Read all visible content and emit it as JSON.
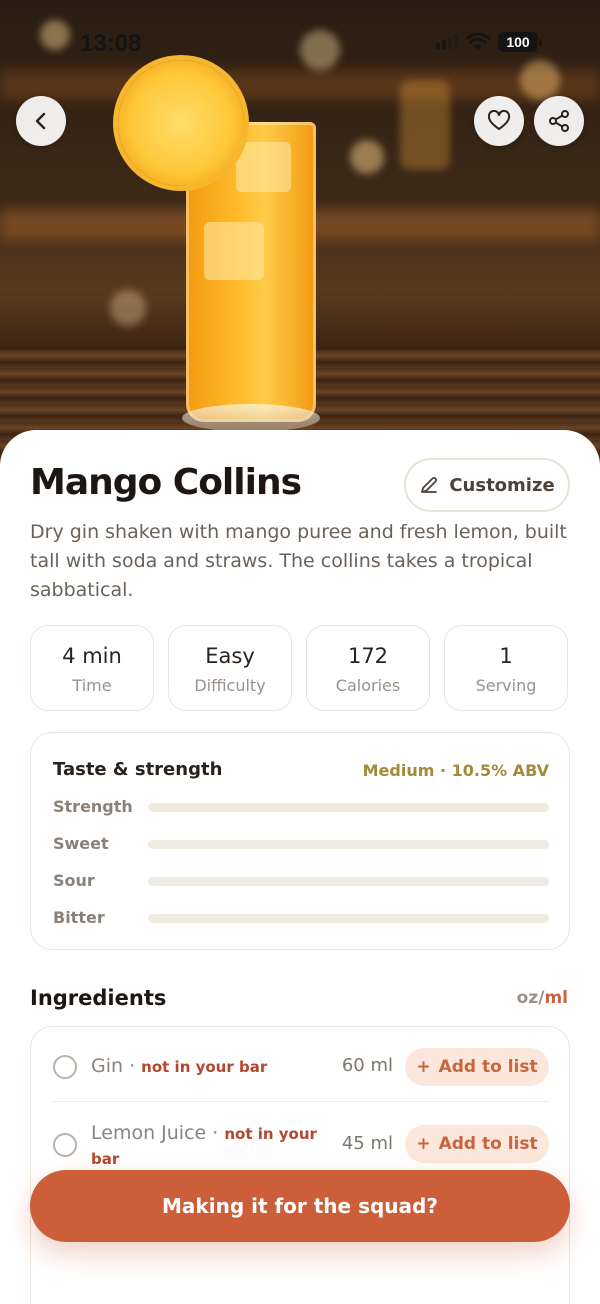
{
  "status_bar": {
    "time": "13:08",
    "battery": "100"
  },
  "header": {
    "back_icon": "chevron-left-icon",
    "favorite_icon": "heart-icon",
    "share_icon": "share-icon"
  },
  "recipe": {
    "title": "Mango Collins",
    "customize_label": "Customize",
    "description": "Dry gin shaken with mango puree and fresh lemon, built tall with soda and straws. The collins takes a tropical sabbatical.",
    "stats": [
      {
        "value": "4 min",
        "label": "Time"
      },
      {
        "value": "Easy",
        "label": "Difficulty"
      },
      {
        "value": "172",
        "label": "Calories"
      },
      {
        "value": "1",
        "label": "Serving"
      }
    ]
  },
  "taste": {
    "title": "Taste & strength",
    "meta": "Medium · 10.5% ABV",
    "rows": [
      {
        "label": "Strength",
        "level": 0
      },
      {
        "label": "Sweet",
        "level": 0
      },
      {
        "label": "Sour",
        "level": 0
      },
      {
        "label": "Bitter",
        "level": 0
      }
    ]
  },
  "ingredients": {
    "title": "Ingredients",
    "unit_oz": "oz",
    "unit_sep": "/",
    "unit_ml": "ml",
    "items": [
      {
        "name": "Gin",
        "note": "not in your bar",
        "amount": "60 ml",
        "action": "Add to list"
      },
      {
        "name": "Lemon Juice",
        "note": "not in your bar",
        "amount": "45 ml",
        "action": "Add to list"
      }
    ]
  },
  "cta": {
    "label": "Making it for the squad?"
  },
  "colors": {
    "accent": "#cc5f39",
    "accent_soft": "#fbe7dc",
    "meta_gold": "#a58a3a",
    "note_red": "#b4462d"
  }
}
